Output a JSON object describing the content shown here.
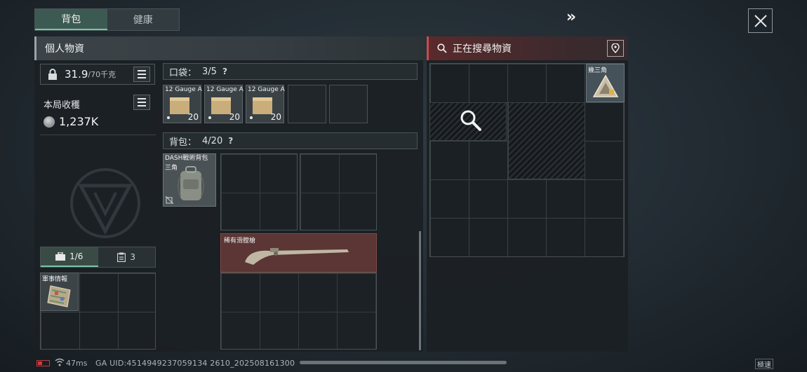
{
  "tabs": [
    {
      "label": "背包",
      "active": true
    },
    {
      "label": "健康",
      "active": false
    }
  ],
  "top": {
    "forward_icon": "double-chevron-right-icon",
    "close_icon": "close-icon"
  },
  "personal": {
    "header": "個人物資",
    "weight_value": "31.9",
    "weight_max": "/70千克",
    "harvest_label": "本局收穫",
    "harvest_value": "1,237K",
    "mini_tabs": [
      {
        "label": "1/6",
        "icon": "briefcase-icon",
        "active": true
      },
      {
        "label": "3",
        "icon": "clipboard-icon",
        "active": false
      }
    ],
    "intel_item_label": "軍事情報"
  },
  "pocket": {
    "label": "口袋：",
    "count": "3/5",
    "help": "?",
    "items": [
      {
        "label": "12 Gauge A",
        "count": "20"
      },
      {
        "label": "12 Gauge A",
        "count": "20"
      },
      {
        "label": "12 Gauge A",
        "count": "20"
      }
    ]
  },
  "backpack": {
    "label": "背包：",
    "count": "4/20",
    "help": "?",
    "bag_item_label": "DASH戰術背包",
    "bag_item_sub": "三角",
    "rifle_label": "稀有滑膛槍"
  },
  "search": {
    "header": "正在搜尋物資",
    "triangle_item_label": "幾三角"
  },
  "status": {
    "ping": "47ms",
    "uid": "GA UID:4514949237059134 2610_202508161300",
    "speed": "極速"
  },
  "colors": {
    "accent_green": "#79c5a7",
    "search_red": "#c84c4c",
    "rifle_bg": "#5b3634"
  }
}
